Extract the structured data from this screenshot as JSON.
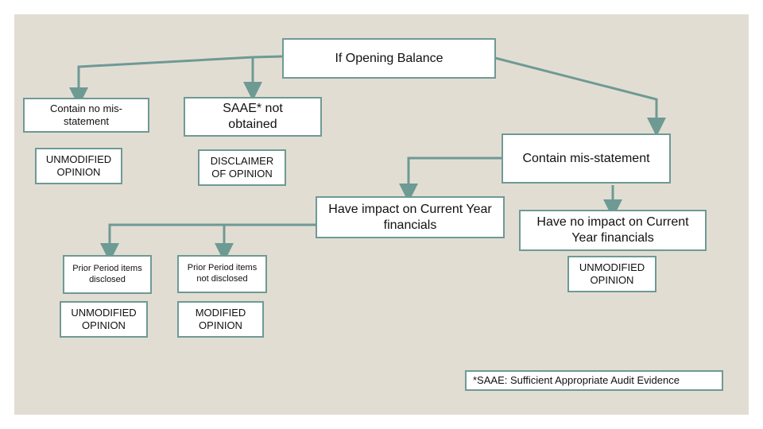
{
  "diagram": {
    "root": "If Opening Balance",
    "no_misstatement": "Contain no mis-statement",
    "no_misstatement_opinion": "UNMODIFIED OPINION",
    "saae_not_obtained": "SAAE* not obtained",
    "saae_opinion": "DISCLAIMER OF OPINION",
    "contain_misstatement": "Contain mis-statement",
    "have_impact": "Have impact on Current Year financials",
    "no_impact": "Have no impact on Current Year financials",
    "no_impact_opinion": "UNMODIFIED OPINION",
    "prior_disclosed": "Prior Period items disclosed",
    "prior_disclosed_opinion": "UNMODIFIED OPINION",
    "prior_not_disclosed": "Prior Period items not disclosed",
    "prior_not_disclosed_opinion": "MODIFIED OPINION",
    "footnote": "*SAAE: Sufficient Appropriate Audit Evidence"
  },
  "colors": {
    "background": "#e2ddd3",
    "connector": "#6e9a94",
    "box_fill": "#ffffff"
  }
}
